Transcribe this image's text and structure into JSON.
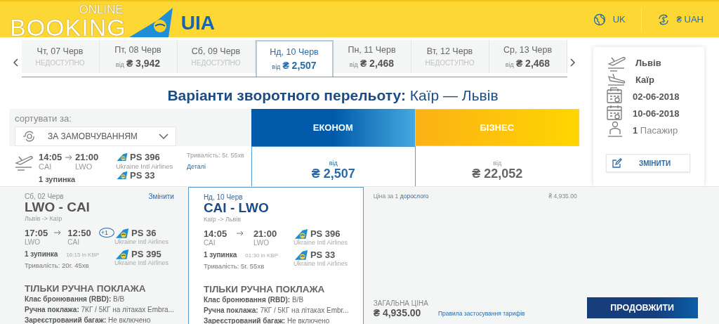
{
  "header": {
    "logo_top": "ONLINE",
    "logo_main": "BOOKING",
    "brand": "UIA",
    "language": "UK",
    "currency": "₴ UAH"
  },
  "date_tabs": [
    {
      "day": "Чт, 07 Черв",
      "kind": "unavailable",
      "status": "НЕДОСТУПНО",
      "selected": false
    },
    {
      "day": "Пт, 08 Черв",
      "kind": "price",
      "prefix": "від",
      "price": "₴ 3,942",
      "selected": false
    },
    {
      "day": "Сб, 09 Черв",
      "kind": "unavailable",
      "status": "НЕДОСТУПНО",
      "selected": false
    },
    {
      "day": "Нд, 10 Черв",
      "kind": "price",
      "prefix": "від",
      "price": "₴ 2,507",
      "selected": true
    },
    {
      "day": "Пн, 11 Черв",
      "kind": "price",
      "prefix": "від",
      "price": "₴ 2,468",
      "selected": false
    },
    {
      "day": "Вт, 12 Черв",
      "kind": "unavailable",
      "status": "НЕДОСТУПНО",
      "selected": false
    },
    {
      "day": "Ср, 13 Черв",
      "kind": "price",
      "prefix": "від",
      "price": "₴ 2,468",
      "selected": false
    }
  ],
  "title": {
    "label": "Варіанти зворотного перельоту:",
    "route": "Каїр — Львів"
  },
  "sort": {
    "label": "сортувати за:",
    "value": "ЗА ЗАМОВЧУВАННЯМ"
  },
  "fare_classes": [
    {
      "label": "ЕКОНОМ",
      "kind": "economy"
    },
    {
      "label": "БІЗНЕС",
      "kind": "business"
    }
  ],
  "flight": {
    "dep_time": "14:05",
    "arr_time": "21:00",
    "dep_code": "CAI",
    "arr_code": "LWO",
    "stops": "1 зупинка",
    "segments": [
      {
        "number": "PS 396",
        "airline": "Ukraine Intl Airlines"
      },
      {
        "number": "PS 33"
      }
    ],
    "duration": "Тривалість: 5г. 55хв",
    "details_link": "Деталі",
    "fares": [
      {
        "prefix": "від",
        "price": "₴ 2,507",
        "selected": true
      },
      {
        "prefix": "від",
        "price": "₴ 22,052",
        "selected": false
      }
    ]
  },
  "summary": {
    "items": [
      {
        "kind": "depart",
        "text": "Львів"
      },
      {
        "kind": "arrive",
        "text": "Каїр"
      },
      {
        "kind": "date",
        "text": "02-06-2018"
      },
      {
        "kind": "date",
        "text": "10-06-2018"
      },
      {
        "kind": "passenger",
        "count": "1",
        "text": "Пасажир"
      }
    ],
    "button": "ЗМІНИТИ"
  },
  "legs": [
    {
      "date": "Сб, 02 Черв",
      "change_link": "Змінити",
      "code": "LWO - CAI",
      "cities": "Львів -> Каїр",
      "dep_time": "17:05",
      "arr_time": "12:50",
      "next_day": "+1",
      "dep_code": "LWO",
      "arr_code": "CAI",
      "stops": "1 зупинка",
      "stopover": "16:15 in KBP",
      "duration": "Тривалість: 20г. 45хв",
      "segments": [
        {
          "number": "PS 36",
          "airline": "Ukraine Intl Airlines"
        },
        {
          "number": "PS 395",
          "airline": "Ukraine Intl Airlines"
        }
      ],
      "baggage_title": "ТІЛЬКИ РУЧНА ПОКЛАЖА",
      "details": [
        {
          "label": "Клас бронювання (RBD):",
          "value": "B/B"
        },
        {
          "label": "Ручна поклажа:",
          "value": "7КГ / 5КГ на літаках Embra..."
        },
        {
          "label": "Зареєстрований багаж:",
          "value": "Не включено"
        }
      ],
      "selected": false
    },
    {
      "date": "Нд, 10 Черв",
      "code": "CAI - LWO",
      "cities": "Каїр -> Львів",
      "dep_time": "14:05",
      "arr_time": "21:00",
      "dep_code": "CAI",
      "arr_code": "LWO",
      "stops": "1 зупинка",
      "stopover": "01:30 in KBP",
      "duration": "Тривалість: 5г. 55хв",
      "segments": [
        {
          "number": "PS 396",
          "airline": "Ukraine Intl Airlines"
        },
        {
          "number": "PS 33",
          "airline": "Ukraine Intl Airlines"
        }
      ],
      "baggage_title": "ТІЛЬКИ РУЧНА ПОКЛАЖА",
      "details": [
        {
          "label": "Клас бронювання (RBD):",
          "value": "B/B"
        },
        {
          "label": "Ручна поклажа:",
          "value": "7КГ / 5КГ на літаках Embr..."
        },
        {
          "label": "Зареєстрований багаж:",
          "value": "Не включено"
        }
      ],
      "selected": true
    }
  ],
  "price": {
    "per_label": "Ціна за 1",
    "per_link": "дорослого",
    "per_amount": "₴ 4,935.00",
    "total_label": "ЗАГАЛЬНА ЦІНА",
    "total": "₴ 4,935.00",
    "rules_link": "Правила застосування тарифів",
    "continue_button": "ПРОДОВЖИТИ"
  }
}
